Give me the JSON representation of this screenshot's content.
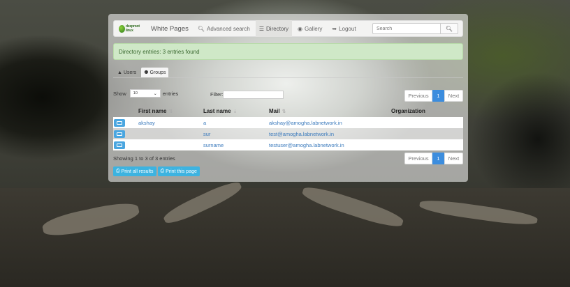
{
  "navbar": {
    "brand_logo_text": "deeproot linux",
    "brand_title": "White Pages",
    "links": [
      {
        "icon": "search-icon",
        "label": "Advanced search"
      },
      {
        "icon": "list-icon",
        "label": "Directory"
      },
      {
        "icon": "camera-icon",
        "label": "Gallery"
      },
      {
        "icon": "logout-icon",
        "label": "Logout"
      }
    ],
    "search_placeholder": "Search"
  },
  "alert": {
    "text": "Directory entries: 3 entries found"
  },
  "tabs": [
    {
      "icon": "user-icon",
      "label": "Users"
    },
    {
      "icon": "group-icon",
      "label": "Groups"
    }
  ],
  "controls": {
    "show_label": "Show",
    "length_value": "10",
    "entries_label": "entries",
    "filter_label": "Filter:"
  },
  "pager": {
    "previous": "Previous",
    "current": "1",
    "next": "Next"
  },
  "table": {
    "columns": [
      "First name",
      "Last name",
      "Mail",
      "Organization"
    ],
    "rows": [
      {
        "first": "akshay",
        "last": "a",
        "mail": "akshay@amogha.labnetwork.in",
        "org": ""
      },
      {
        "first": "",
        "last": "sur",
        "mail": "test@amogha.labnetwork.in",
        "org": ""
      },
      {
        "first": "",
        "last": "surname",
        "mail": "testuser@amogha.labnetwork.in",
        "org": ""
      }
    ]
  },
  "footer": {
    "showing": "Showing 1 to 3 of 3 entries",
    "print_all": "Print all results",
    "print_page": "Print this page"
  },
  "colors": {
    "accent_blue": "#3c8dde",
    "alert_bg": "#cfe8c7",
    "print_button": "#3db3e0"
  }
}
